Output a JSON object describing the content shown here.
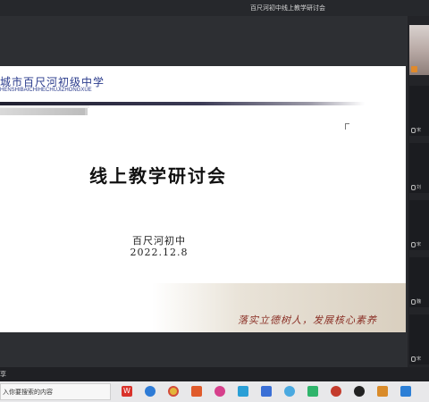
{
  "window": {
    "title": "百尺河初中线上教学研讨会"
  },
  "slide": {
    "school_name": "城市百尺河初级中学",
    "school_pinyin": "HENSHIBAICHIHECHUJIZHONGXUE",
    "title": "线上教学研讨会",
    "organizer": "百尺河初中",
    "date": "2022.12.8",
    "slogan": "落实立德树人，发展核心素养"
  },
  "participants": [
    {
      "label": ""
    },
    {
      "label": "宋"
    },
    {
      "label": "刘"
    },
    {
      "label": "宋"
    },
    {
      "label": "魏"
    },
    {
      "label": "宋"
    },
    {
      "label": "吴"
    }
  ],
  "status_bar": {
    "text": "享"
  },
  "taskbar": {
    "search_placeholder": "入你要搜索的内容"
  },
  "colors": {
    "accent_school": "#2a3b8c",
    "slogan": "#8a2f25",
    "badge": "#e08a2b"
  },
  "taskbar_icons": [
    "wps-icon",
    "sync-icon",
    "chrome-icon",
    "media-icon",
    "app-icon",
    "store-icon",
    "file-icon",
    "chat-icon",
    "green-icon",
    "penguin-icon",
    "qq-icon",
    "game-icon",
    "window-icon"
  ]
}
